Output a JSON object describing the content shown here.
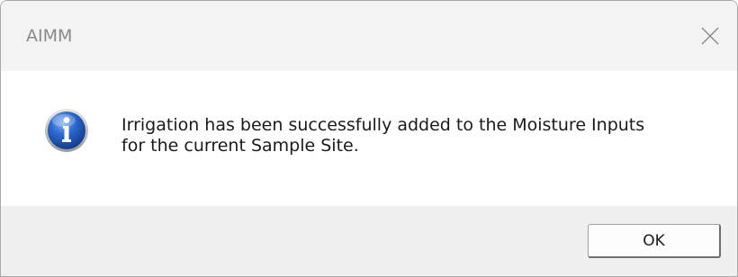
{
  "window": {
    "title": "AIMM"
  },
  "titlebar": {
    "close_icon": "close-icon"
  },
  "message": {
    "icon": "info-icon",
    "line1": "Irrigation has been successfully added to the Moisture Inputs",
    "line2": "for the current Sample Site."
  },
  "buttons": {
    "ok_label": "OK"
  },
  "colors": {
    "icon_blue": "#1f56b8",
    "titlebar_bg": "#f3f3f3",
    "footer_bg": "#f0f0f0"
  }
}
